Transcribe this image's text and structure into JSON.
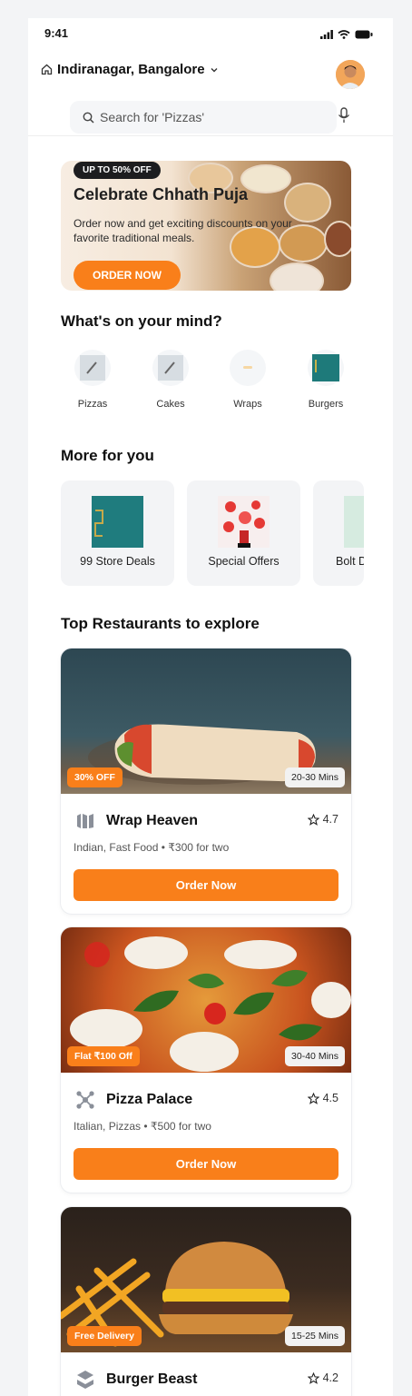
{
  "status": {
    "time": "9:41"
  },
  "header": {
    "location": "Indiranagar, Bangalore"
  },
  "search": {
    "placeholder": "Search for 'Pizzas'"
  },
  "banner": {
    "tag": "UP TO 50% OFF",
    "title": "Celebrate Chhath Puja",
    "desc": "Order now and get exciting discounts on your favorite traditional meals.",
    "cta": "ORDER NOW"
  },
  "sections": {
    "mind": "What's on your mind?",
    "more": "More for you",
    "top": "Top Restaurants to explore"
  },
  "categories": [
    {
      "label": "Pizzas"
    },
    {
      "label": "Cakes"
    },
    {
      "label": "Wraps"
    },
    {
      "label": "Burgers"
    }
  ],
  "more": [
    {
      "label": "99 Store Deals"
    },
    {
      "label": "Special Offers"
    },
    {
      "label": "Bolt D"
    }
  ],
  "restaurants": [
    {
      "name": "Wrap Heaven",
      "rating": "4.7",
      "meta": "Indian, Fast Food • ₹300 for two",
      "offer": "30% OFF",
      "eta": "20-30 Mins",
      "cta": "Order Now"
    },
    {
      "name": "Pizza Palace",
      "rating": "4.5",
      "meta": "Italian, Pizzas • ₹500 for two",
      "offer": "Flat ₹100 Off",
      "eta": "30-40 Mins",
      "cta": "Order Now"
    },
    {
      "name": "Burger Beast",
      "rating": "4.2",
      "meta": "",
      "offer": "Free Delivery",
      "eta": "15-25 Mins",
      "cta": ""
    }
  ],
  "colors": {
    "accent": "#f97f1a",
    "dark": "#1d1d1f"
  }
}
